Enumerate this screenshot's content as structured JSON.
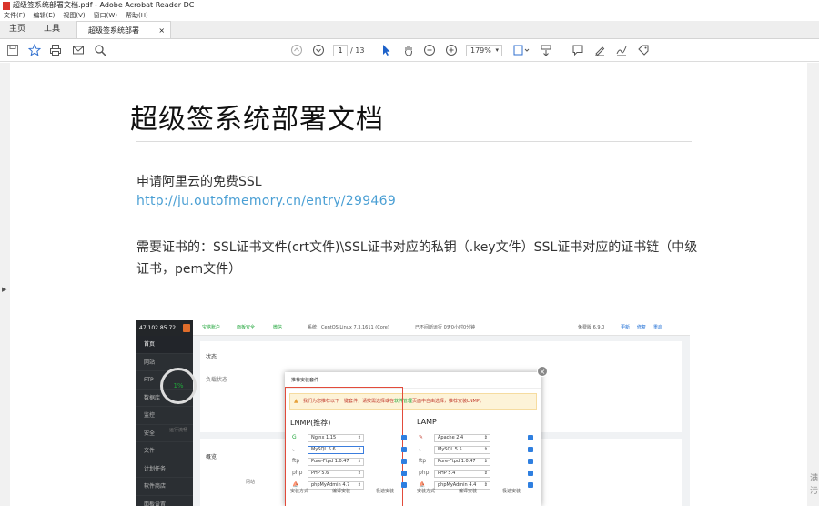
{
  "window": {
    "title": "超级签系统部署文档.pdf - Adobe Acrobat Reader DC"
  },
  "menu": [
    "文件(F)",
    "编辑(E)",
    "视图(V)",
    "窗口(W)",
    "帮助(H)"
  ],
  "tabs": {
    "home": "主页",
    "tools": "工具",
    "doc": "超级签系统部署文...",
    "doc_close": "×"
  },
  "toolbar": {
    "page_current": "1",
    "page_total": "/ 13",
    "zoom": "179%"
  },
  "document": {
    "title": "超级签系统部署文档",
    "p1": "申请阿里云的免费SSL",
    "link": "http://ju.outofmemory.cn/entry/299469",
    "p2": "需要证书的：SSL证书文件(crt文件)\\SSL证书对应的私钥（.key文件）SSL证书对应的证书链（中级证书，pem文件）"
  },
  "screenshot": {
    "ip": "47.102.85.72",
    "sidebar": [
      "首页",
      "网站",
      "FTP",
      "数据库",
      "监控",
      "安全",
      "文件",
      "计划任务",
      "软件商店",
      "面板设置"
    ],
    "topbar": {
      "account": "宝塔账户",
      "sec": "面板安全",
      "weixin": "微信",
      "sys": "系统：CentOS Linux 7.3.1611 (Core)",
      "uptime": "已不间断运行 0天0小时0分钟",
      "version": "免费版 6.9.0",
      "update": "更新",
      "repair": "修复",
      "restart": "重启"
    },
    "status_label": "状态",
    "load_label": "负载状态",
    "gauge": "1%",
    "gauge_caption": "运行流畅",
    "overview_label": "概览",
    "overview_sub": "网站",
    "modal": {
      "title": "推荐安装套件",
      "warn_a": "我们为您推荐以下一键套件，请按需选择或在",
      "warn_link": "软件管理",
      "warn_b": "页面中自由选择，推荐安装LNMP。",
      "close": "×",
      "lnmp": {
        "title": "LNMP(推荐)",
        "rows": [
          "Nginx 1.15",
          "MySQL 5.6",
          "Pure-Ftpd 1.0.47",
          "PHP 5.6",
          "phpMyAdmin 4.7"
        ],
        "foot": [
          "安装方式",
          "编译安装",
          "极速安装"
        ]
      },
      "lamp": {
        "title": "LAMP",
        "rows": [
          "Apache 2.4",
          "MySQL 5.5",
          "Pure-Ftpd 1.0.47",
          "PHP 5.4",
          "phpMyAdmin 4.4"
        ],
        "foot": [
          "安装方式",
          "编译安装",
          "极速安装"
        ]
      }
    }
  }
}
